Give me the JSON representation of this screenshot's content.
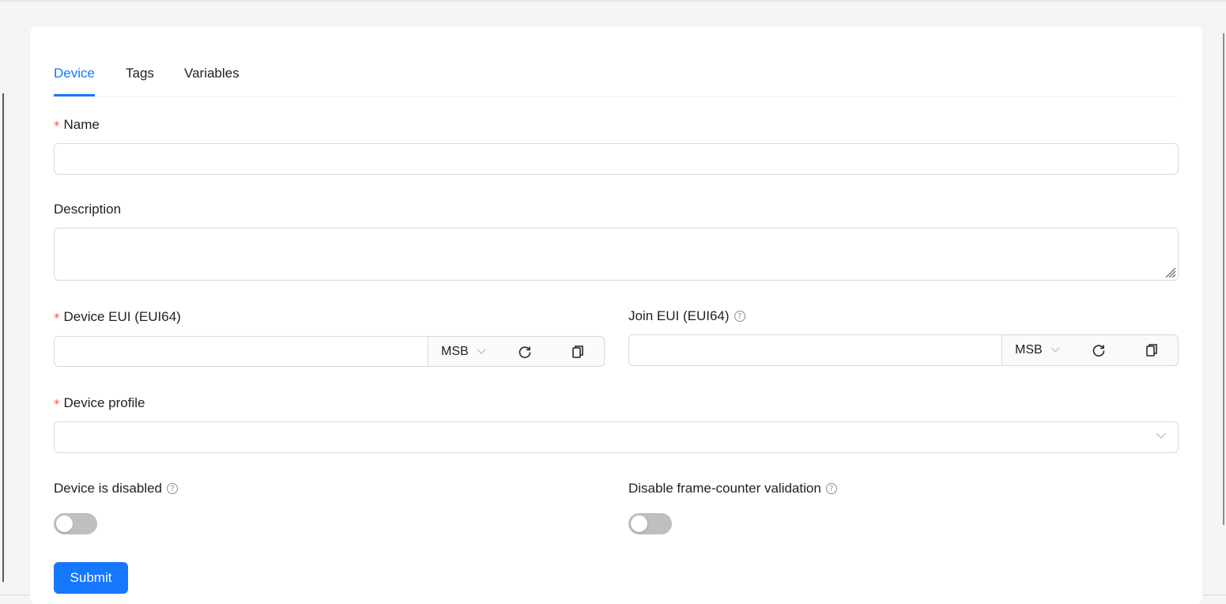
{
  "tabs": [
    {
      "label": "Device",
      "active": true
    },
    {
      "label": "Tags",
      "active": false
    },
    {
      "label": "Variables",
      "active": false
    }
  ],
  "form": {
    "name": {
      "label": "Name",
      "required": true,
      "value": ""
    },
    "description": {
      "label": "Description",
      "required": false,
      "value": ""
    },
    "dev_eui": {
      "label": "Device EUI (EUI64)",
      "required": true,
      "value": "",
      "byte_order": "MSB",
      "icons": [
        "refresh-icon",
        "copy-icon"
      ]
    },
    "join_eui": {
      "label": "Join EUI (EUI64)",
      "required": false,
      "value": "",
      "byte_order": "MSB",
      "help": "question-circle-icon",
      "icons": [
        "refresh-icon",
        "copy-icon"
      ]
    },
    "device_profile": {
      "label": "Device profile",
      "required": true,
      "value": ""
    },
    "is_disabled": {
      "label": "Device is disabled",
      "help": "question-circle-icon",
      "checked": false
    },
    "skip_fcnt_check": {
      "label": "Disable frame-counter validation",
      "help": "question-circle-icon",
      "checked": false
    },
    "submit_label": "Submit"
  },
  "colors": {
    "primary": "#1677ff",
    "required_mark": "#ff4d4f",
    "switch_off": "#bfbfbf",
    "border": "#d9d9d9"
  }
}
